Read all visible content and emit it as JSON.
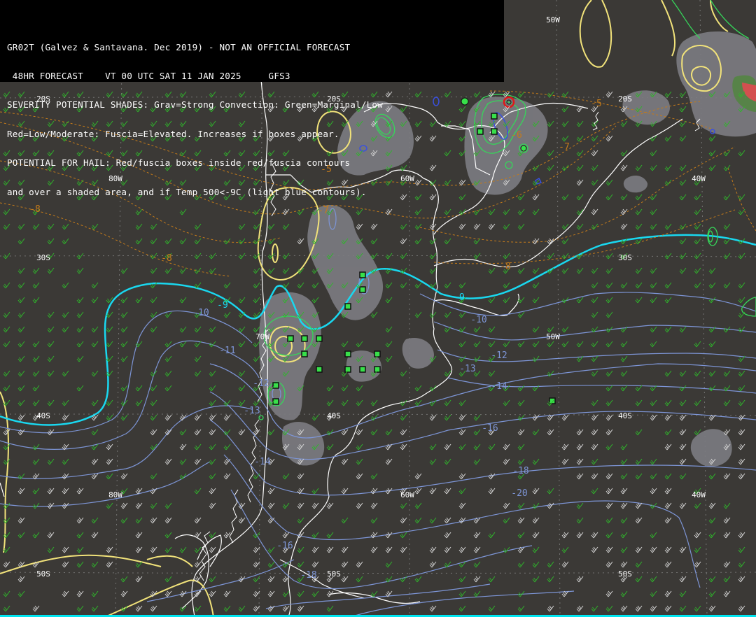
{
  "header": {
    "line1": "GR02T (Galvez & Santavana. Dec 2019) - NOT AN OFFICIAL FORECAST",
    "line2": " 48HR FORECAST    VT 00 UTC SAT 11 JAN 2025     GFS3",
    "line3": "SEVERITY POTENTIAL SHADES: Grav=Strong Convection: Green=Marginal/Low",
    "line4": "Red=Low/Moderate: Fuscia=Elevated. Increases if boxes appear.",
    "line5": "POTENTIAL FOR HAIL: Red/fuscia boxes inside red/fuscia contours",
    "line6": "and over a shaded area, and if Temp 500<-9C (light blue contours)."
  },
  "lat_labels": [
    "20S",
    "20S",
    "20S",
    "30S",
    "30S",
    "40S",
    "40S",
    "40S",
    "50S",
    "50S",
    "50S"
  ],
  "lon_labels": [
    "50W",
    "80W",
    "60W",
    "40W",
    "50W",
    "80W",
    "60W",
    "40W",
    "70W"
  ],
  "contour_labels": {
    "orange": [
      "-5",
      "-5",
      "-6",
      "-7",
      "-7",
      "-8",
      "-8",
      "-8"
    ],
    "cyan": [
      "-9",
      "-9"
    ],
    "blue": [
      "-10",
      "-10",
      "-11",
      "-12",
      "-12",
      "-13",
      "-13",
      "-14",
      "-14",
      "-16",
      "-16",
      "-18",
      "-18",
      "-20"
    ]
  },
  "colors": {
    "background": "#3b3936",
    "coast": "#ffffff",
    "shade": "#8a8a8e",
    "shade_dark": "#6e6e72",
    "yellow_contour": "#f1e27a",
    "cyan_contour": "#19d8f0",
    "blue_contour": "#7d95d6",
    "orange_contour": "#c47b1a",
    "green_contour": "#36d65a",
    "wind_green": "#2fb52b",
    "wind_white": "#d9d9d9",
    "box_green": "#38e04a",
    "hail_red": "#e01818"
  }
}
